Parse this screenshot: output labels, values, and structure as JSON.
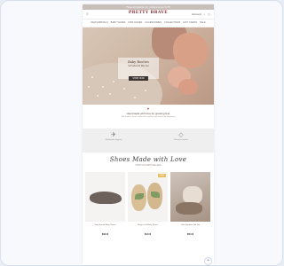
{
  "promo": {
    "text": "Free shipping on orders over $75"
  },
  "header": {
    "logo": "PRETTY BRAVE",
    "left_text": "☰",
    "account": "Account",
    "search_icon": "⌕",
    "cart_icon": "▢"
  },
  "nav": {
    "items": [
      "NEW ARRIVALS",
      "BABY SHOES",
      "KIDS SHOES",
      "ACCESSORIES",
      "COLLECTIONS",
      "GIFT CARDS",
      "SALE"
    ]
  },
  "hero": {
    "title": "Baby Booties",
    "subtitle": "Soft soles for little feet",
    "button": "SHOP NOW"
  },
  "intro": {
    "heart": "♥",
    "title": "Handmade with love for growing feet",
    "text": "Soft leather shoes crafted for comfort and natural development"
  },
  "features": [
    {
      "icon": "✈",
      "label": "Worldwide shipping"
    },
    {
      "icon": "◇",
      "label": "Premium leather"
    }
  ],
  "collection": {
    "title": "Shoes Made with Love",
    "subtitle": "SHOP OUR BESTSELLERS"
  },
  "products": [
    {
      "badge": "",
      "name": "Grey Suede Baby Shoes",
      "price": "$38.00"
    },
    {
      "badge": "NEW",
      "name": "Beige Leaf Baby Shoes",
      "price": "$42.00"
    },
    {
      "badge": "",
      "name": "Little Explorer Gift Set",
      "price": "$65.00"
    }
  ],
  "fab": {
    "icon": "+"
  }
}
